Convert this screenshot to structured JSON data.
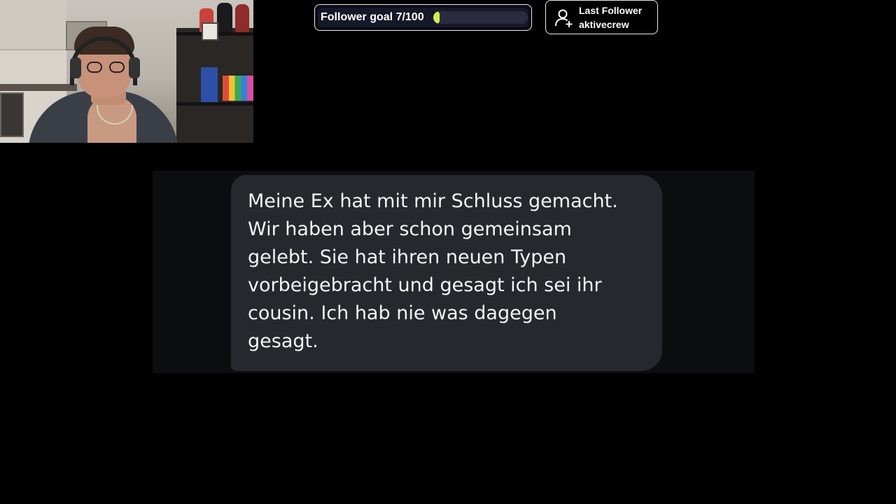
{
  "overlay": {
    "follower_goal": {
      "label": "Follower goal 7/100",
      "current": 7,
      "target": 100,
      "progress_fraction": 0.07,
      "fill_color": "#d1f04a"
    },
    "last_follower": {
      "title": "Last Follower",
      "username": "aktivecrew",
      "icon": "add-user-icon"
    }
  },
  "webcam": {
    "label": "streamer webcam feed"
  },
  "message": {
    "text": "Meine Ex hat mit mir Schluss gemacht.\nWir haben aber schon gemeinsam\ngelebt. Sie hat ihren neuen Typen\nvorbeigebracht und gesagt ich sei ihr\ncousin. Ich hab nie was dagegen\ngesagt."
  },
  "colors": {
    "background": "#000000",
    "bubble": "#26282d",
    "panel": "#0c0d10"
  }
}
